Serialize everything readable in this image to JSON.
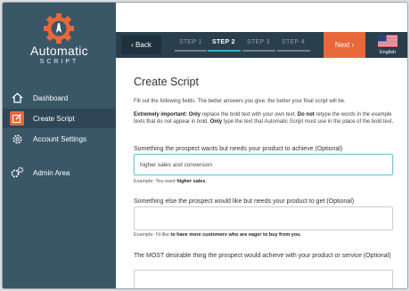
{
  "sidebar": {
    "logo_title": "Automatic",
    "logo_sub": "SCRIPT",
    "items": [
      {
        "label": "Dashboard",
        "icon": "home-icon"
      },
      {
        "label": "Create Script",
        "icon": "edit-icon"
      },
      {
        "label": "Account Settings",
        "icon": "gear-icon"
      },
      {
        "label": "Admin Area",
        "icon": "gears-icon"
      }
    ]
  },
  "stepbar": {
    "back_label": "‹ Back",
    "steps": [
      "STEP 1",
      "STEP 2",
      "STEP 3",
      "STEP 4"
    ],
    "active_step": 2,
    "next_label": "Next ›",
    "language": "English"
  },
  "main": {
    "title": "Create Script",
    "intro": "Fill out the following fields. The better answers you give, the better your final script will be.",
    "important_lead": "Extremely important:",
    "important_only": "Only",
    "important_text1": " replace the bold text with your own text. ",
    "important_do": "Do not",
    "important_text2": " retype the words in the example texts that do not appear in bold. ",
    "important_only2": "Only",
    "important_text3": " type the text that Automatic Script must use in the place of the bold text.",
    "questions": [
      {
        "label": "Something the prospect wants but needs your product to achieve (Optional)",
        "value": "higher sales and conversion",
        "example_prefix": "Example: You want ",
        "example_bold": "higher sales",
        "example_suffix": "."
      },
      {
        "label": "Something else the prospect would like but needs your product to get (Optional)",
        "value": "",
        "example_prefix": "Example: I'd like ",
        "example_bold": "to have more customers who are eager to buy from you",
        "example_suffix": "."
      },
      {
        "label": "The MOST desirable thing the prospect would achieve with your product or service (Optional)",
        "value": ""
      }
    ]
  },
  "colors": {
    "sidebar": "#3a5768",
    "stepbar": "#2a3f4c",
    "accent": "#e8683a",
    "step_active_line": "#2bb3c6"
  }
}
